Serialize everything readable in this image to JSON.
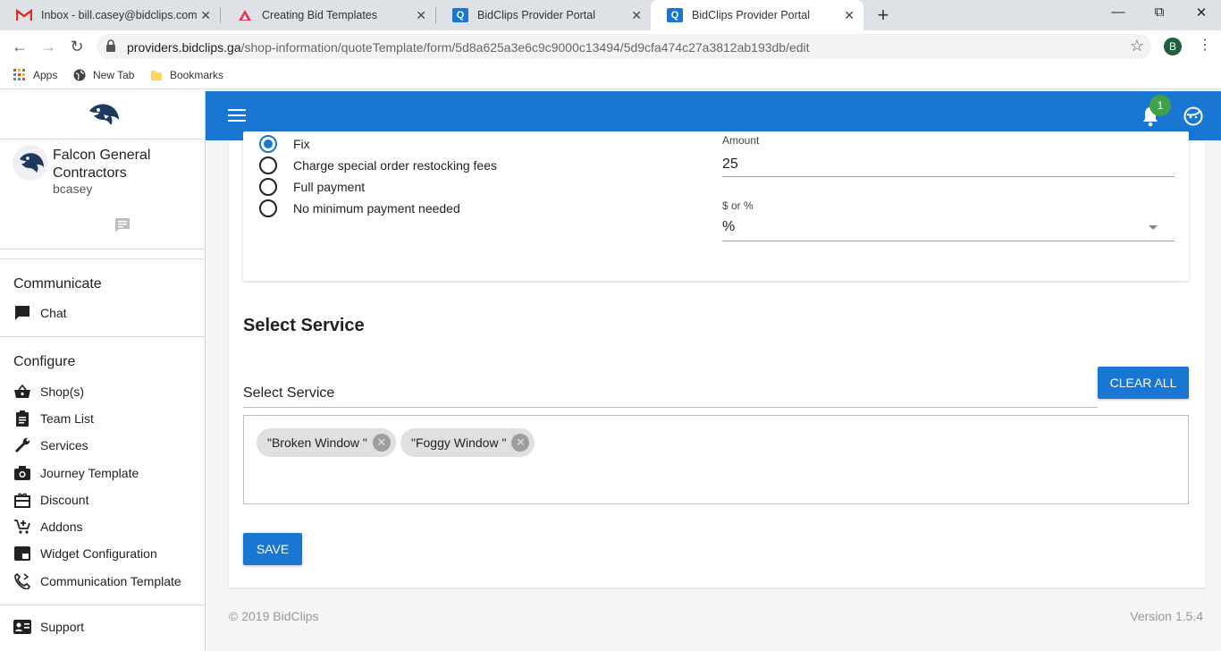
{
  "browser": {
    "tabs": [
      {
        "title": "Inbox - bill.casey@bidclips.com -"
      },
      {
        "title": "Creating Bid Templates"
      },
      {
        "title": "BidClips Provider Portal"
      },
      {
        "title": "BidClips Provider Portal"
      }
    ],
    "new_tab": "+",
    "url_domain": "providers.bidclips.ga",
    "url_path": "/shop-information/quoteTemplate/form/5d8a625a3e6c9c9000c13494/5d9cfa474c27a3812ab193db/edit",
    "profile_initial": "B",
    "bookmarks": [
      {
        "label": "Apps"
      },
      {
        "label": "New Tab"
      },
      {
        "label": "Bookmarks"
      }
    ]
  },
  "sidebar": {
    "company": "Falcon General Contractors",
    "username": "bcasey",
    "communicate_title": "Communicate",
    "communicate_items": [
      {
        "label": "Chat",
        "icon": "chat-icon"
      }
    ],
    "configure_title": "Configure",
    "configure_items": [
      {
        "label": "Shop(s)",
        "icon": "basket-icon"
      },
      {
        "label": "Team List",
        "icon": "clipboard-icon"
      },
      {
        "label": "Services",
        "icon": "wrench-icon"
      },
      {
        "label": "Journey Template",
        "icon": "camera-icon"
      },
      {
        "label": "Discount",
        "icon": "gift-icon"
      },
      {
        "label": "Addons",
        "icon": "cart-add-icon"
      },
      {
        "label": "Widget Configuration",
        "icon": "widget-icon"
      },
      {
        "label": "Communication Template",
        "icon": "phone-forward-icon"
      }
    ],
    "support": {
      "label": "Support",
      "icon": "contact-card-icon"
    }
  },
  "appbar": {
    "notification_count": "1",
    "accent": "#1976d2",
    "badge_color": "#43a047"
  },
  "payment": {
    "options": [
      {
        "label": "Fix",
        "selected": true
      },
      {
        "label": "Charge special order restocking fees",
        "selected": false
      },
      {
        "label": "Full payment",
        "selected": false
      },
      {
        "label": "No minimum payment needed",
        "selected": false
      }
    ],
    "amount_label": "Amount",
    "amount_value": "25",
    "unit_label": "$ or %",
    "unit_value": "%"
  },
  "select_service": {
    "heading": "Select Service",
    "field_label": "Select Service",
    "clear_all": "CLEAR ALL",
    "chips": [
      "\"Broken Window \"",
      "\"Foggy Window \""
    ],
    "chip_remove": "✕"
  },
  "actions": {
    "save": "SAVE"
  },
  "footer": {
    "copyright": "© 2019 BidClips",
    "version": "Version 1.5.4"
  }
}
